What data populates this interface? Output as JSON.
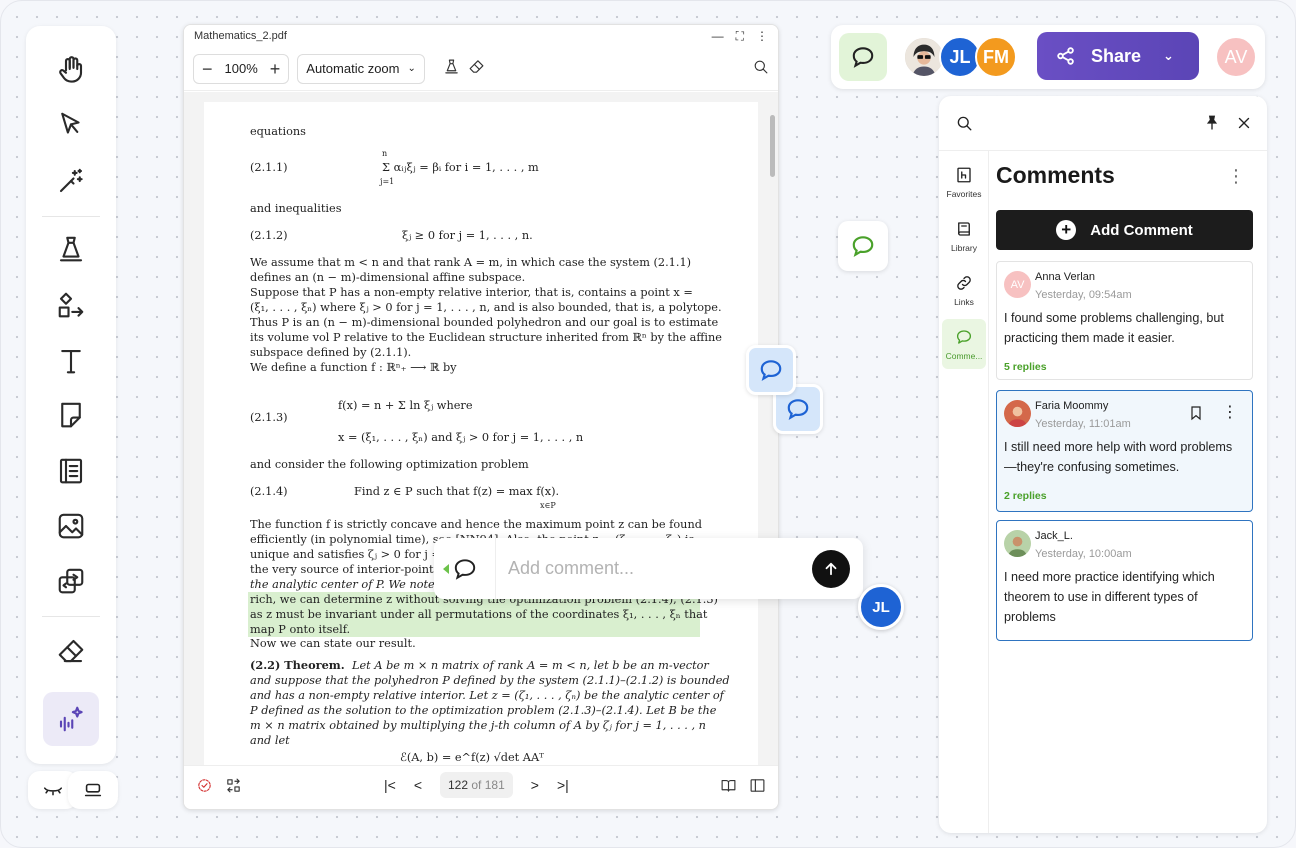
{
  "viewer": {
    "filename": "Mathematics_2.pdf",
    "zoom_minus": "−",
    "zoom_value": "100%",
    "zoom_plus": "+",
    "zoom_mode": "Automatic zoom",
    "page_current": "122",
    "page_of": "of 181",
    "progress_fraction": 0.6
  },
  "pdf": {
    "l1": "equations",
    "eq211_num": "(2.1.1)",
    "eq211": "Σ αᵢⱼξⱼ = βᵢ    for    i = 1, . . . , m",
    "eq211_sub": "j=1",
    "eq211_sup": "n",
    "l2": "and inequalities",
    "eq212_num": "(2.1.2)",
    "eq212": "ξⱼ ≥ 0    for    j = 1, . . . , n.",
    "p1a": "We assume that m < n and that rank A = m, in which case the system (2.1.1)",
    "p1b": "defines an (n − m)-dimensional affine subspace.",
    "p2a": "    Suppose that P has a non-empty relative interior, that is, contains a point x =",
    "p2b": "(ξ₁, . . . , ξₙ) where ξⱼ > 0 for j = 1, . . . , n, and is also bounded, that is, a polytope.",
    "p2c": "Thus P is an (n − m)-dimensional bounded polyhedron and our goal is to estimate",
    "p2d": "its volume vol P relative to the Euclidean structure inherited from ℝⁿ by the affine",
    "p2e": "subspace defined by (2.1.1).",
    "p2f": "    We define a function f : ℝⁿ₊ ⟶ ℝ by",
    "eq213_num": "(2.1.3)",
    "eq213a": "f(x) = n + Σ ln ξⱼ    where",
    "eq213b": "x = (ξ₁, . . . , ξₙ)    and    ξⱼ > 0    for    j = 1, . . . , n",
    "l3": "and consider the following optimization problem",
    "eq214_num": "(2.1.4)",
    "eq214": "Find    z ∈ P    such that    f(z) = max f(x).",
    "eq214_sub": "x∈P",
    "p3a": "The function f is strictly concave and hence the maximum point z can be found",
    "p3b": "efficiently (in polynomial time), see [NN94]. Also, the point z = (ζ₁, . . . , ζₙ) is",
    "p3c": "unique and satisfies ζⱼ > 0 for j = 1, . . . , n.",
    "p3d": "the very source of interior-point methods in optimization.",
    "p3e": "the analytic center of P. We note that the problem is",
    "p3f": "rich, we can determine z without solving the optimization problem (2.1.4), (2.1.3)",
    "p3g": "as z must be invariant under all permutations of the coordinates ξ₁, . . . , ξₙ that",
    "p3h": "map P onto itself.",
    "p3i": "    Now we can state our result.",
    "th_head": "(2.2) Theorem.",
    "th1": "Let A be m × n matrix of rank A = m < n, let b be an m-vector",
    "th2": "and suppose that the polyhedron P defined by the system (2.1.1)–(2.1.2) is bounded",
    "th3": "and has a non-empty relative interior. Let z = (ζ₁, . . . , ζₙ) be the analytic center of",
    "th4": "P defined as the solution to the optimization problem (2.1.3)–(2.1.4). Let B be the",
    "th5": "m × n matrix obtained by multiplying the j-th column of A by ζⱼ for j = 1, . . . , n",
    "th6": "and let",
    "eq_last": "ℰ(A, b) = e^f(z) √det AAᵀ"
  },
  "composer": {
    "placeholder": "Add comment..."
  },
  "floating_avatar": "JL",
  "topbar": {
    "avatars": [
      "JL",
      "FM"
    ],
    "share_label": "Share",
    "me_initials": "AV",
    "colors": {
      "jl": "#1e63d4",
      "fm": "#f39a1e",
      "me": "#f7c1c1",
      "share": "#5d47b8"
    }
  },
  "panel": {
    "title": "Comments",
    "add_label": "Add Comment",
    "rail": [
      {
        "label": "Favorites",
        "icon": "favorites-icon"
      },
      {
        "label": "Library",
        "icon": "library-icon"
      },
      {
        "label": "Links",
        "icon": "link-icon"
      },
      {
        "label": "Comme...",
        "icon": "comment-icon"
      }
    ],
    "comments": [
      {
        "initials": "AV",
        "author": "Anna Verlan",
        "time": "Yesterday, 09:54am",
        "text": "I found some problems challenging, but practicing them made it easier.",
        "replies": "5 replies"
      },
      {
        "author": "Faria Moommy",
        "time": "Yesterday, 11:01am",
        "text": "I still need more help with word problems—they're confusing sometimes.",
        "replies": "2 replies"
      },
      {
        "author": "Jack_L.",
        "time": "Yesterday, 10:00am",
        "text": "I need more practice identifying which theorem to use in different types of problems"
      }
    ]
  }
}
